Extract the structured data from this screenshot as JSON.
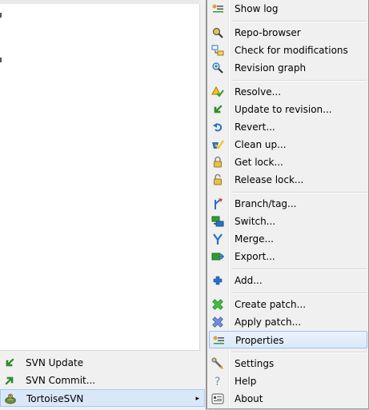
{
  "colors": {
    "menu_bg": "#f0f0f0",
    "highlight_bg": "#dbe9f8",
    "highlight_border": "#9ec2ee",
    "svn_green": "#2e9e2e",
    "svn_blue": "#2a6fc9"
  },
  "left_menu": {
    "items": [
      {
        "label": "SVN Update",
        "icon": "svn-update-icon"
      },
      {
        "label": "SVN Commit...",
        "icon": "svn-commit-icon"
      },
      {
        "label": "TortoiseSVN",
        "icon": "tortoisesvn-icon",
        "submenu_arrow": "▸",
        "active": true
      }
    ]
  },
  "submenu": {
    "items": [
      {
        "label": "Show log",
        "icon": "show-log-icon"
      },
      {
        "label": "Repo-browser",
        "icon": "repo-browser-icon"
      },
      {
        "label": "Check for modifications",
        "icon": "check-modifications-icon"
      },
      {
        "label": "Revision graph",
        "icon": "revision-graph-icon"
      },
      {
        "label": "Resolve...",
        "icon": "resolve-icon"
      },
      {
        "label": "Update to revision...",
        "icon": "update-to-revision-icon"
      },
      {
        "label": "Revert...",
        "icon": "revert-icon"
      },
      {
        "label": "Clean up...",
        "icon": "clean-up-icon"
      },
      {
        "label": "Get lock...",
        "icon": "get-lock-icon"
      },
      {
        "label": "Release lock...",
        "icon": "release-lock-icon"
      },
      {
        "label": "Branch/tag...",
        "icon": "branch-tag-icon"
      },
      {
        "label": "Switch...",
        "icon": "switch-icon"
      },
      {
        "label": "Merge...",
        "icon": "merge-icon"
      },
      {
        "label": "Export...",
        "icon": "export-icon"
      },
      {
        "label": "Add...",
        "icon": "add-icon"
      },
      {
        "label": "Create patch...",
        "icon": "create-patch-icon"
      },
      {
        "label": "Apply patch...",
        "icon": "apply-patch-icon"
      },
      {
        "label": "Properties",
        "icon": "properties-icon",
        "highlighted": true
      },
      {
        "label": "Settings",
        "icon": "settings-icon"
      },
      {
        "label": "Help",
        "icon": "help-icon"
      },
      {
        "label": "About",
        "icon": "about-icon"
      }
    ]
  }
}
